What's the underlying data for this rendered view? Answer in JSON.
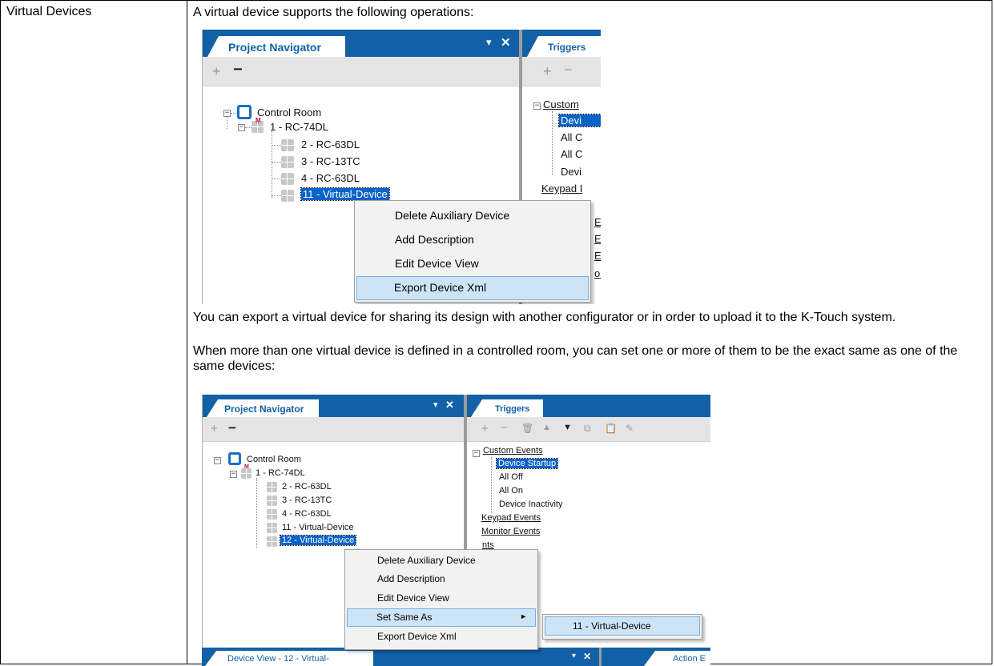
{
  "doc": {
    "row_label": "Virtual Devices",
    "intro": "A virtual device supports the following operations:",
    "para1": "You can export a virtual device for sharing its design with another configurator or in order to upload it to the K-Touch system.",
    "para2": "When more than one virtual device is defined in a controlled room, you can set one or more of them to be the exact same as one of the same devices:"
  },
  "shot1": {
    "navigator_tab": "Project Navigator",
    "triggers_tab": "Triggers",
    "pin_icon": "▾",
    "close_icon": "✕",
    "tree": {
      "root": "Control Room",
      "main": "1 - RC-74DL",
      "items": [
        "2 - RC-63DL",
        "3 - RC-13TC",
        "4 - RC-63DL",
        "11 - Virtual-Device"
      ]
    },
    "right_tree": [
      "Custom",
      "Devi",
      "All C",
      "All C",
      "Devi",
      "Keypad I",
      "r I",
      "E",
      "Ev",
      "E",
      "ou"
    ],
    "menu": [
      "Delete Auxiliary Device",
      "Add Description",
      "Edit Device View",
      "Export Device Xml"
    ]
  },
  "shot2": {
    "navigator_tab": "Project Navigator",
    "triggers_tab": "Triggers",
    "device_view_tab": "Device View - 12 - Virtual-",
    "action_tab": "Action E",
    "tree": {
      "root": "Control Room",
      "main": "1 - RC-74DL",
      "items": [
        "2 - RC-63DL",
        "3 - RC-13TC",
        "4 - RC-63DL",
        "11 - Virtual-Device",
        "12 - Virtual-Device"
      ]
    },
    "right_tree": {
      "custom": "Custom Events",
      "children": [
        "Device Startup",
        "All Off",
        "All On",
        "Device Inactivity"
      ],
      "keypad": "Keypad Events",
      "monitor": "Monitor Events",
      "partial": [
        "nts",
        "nts",
        "nts",
        "es"
      ]
    },
    "menu": [
      "Delete Auxiliary Device",
      "Add Description",
      "Edit Device View",
      "Set Same As",
      "Export Device Xml"
    ],
    "submenu_arrow": "►",
    "submenu": [
      "11 - Virtual-Device"
    ]
  }
}
